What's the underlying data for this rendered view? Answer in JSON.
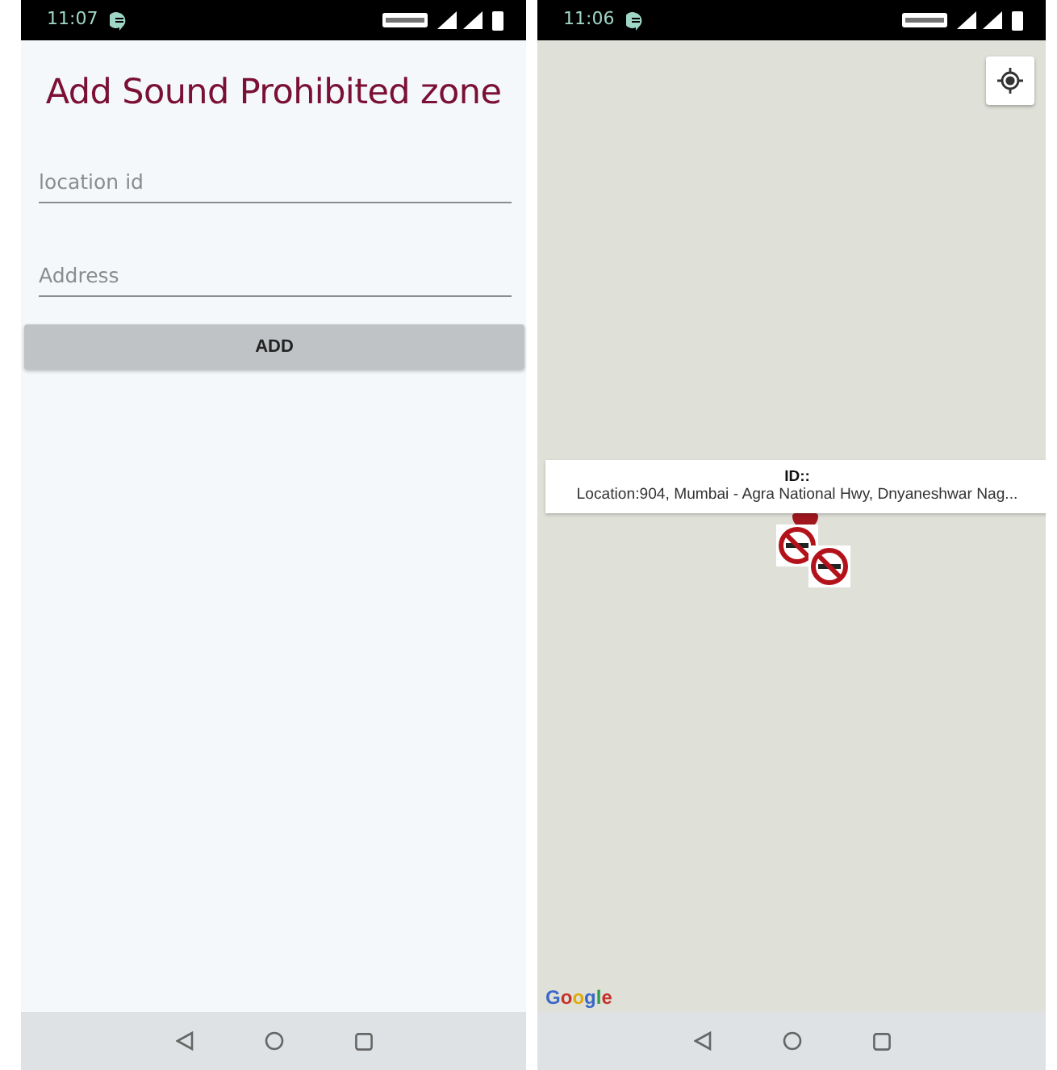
{
  "left_screen": {
    "status_bar": {
      "time": "11:07"
    },
    "title": "Add Sound Prohibited zone",
    "fields": [
      {
        "placeholder": "location id"
      },
      {
        "placeholder": "Address"
      }
    ],
    "button": "ADD"
  },
  "right_screen": {
    "status_bar": {
      "time": "11:06"
    },
    "info_window": {
      "title": "ID::",
      "snippet": "Location:904, Mumbai - Agra National Hwy, Dnyaneshwar Nag..."
    },
    "map_logo": "Google"
  }
}
